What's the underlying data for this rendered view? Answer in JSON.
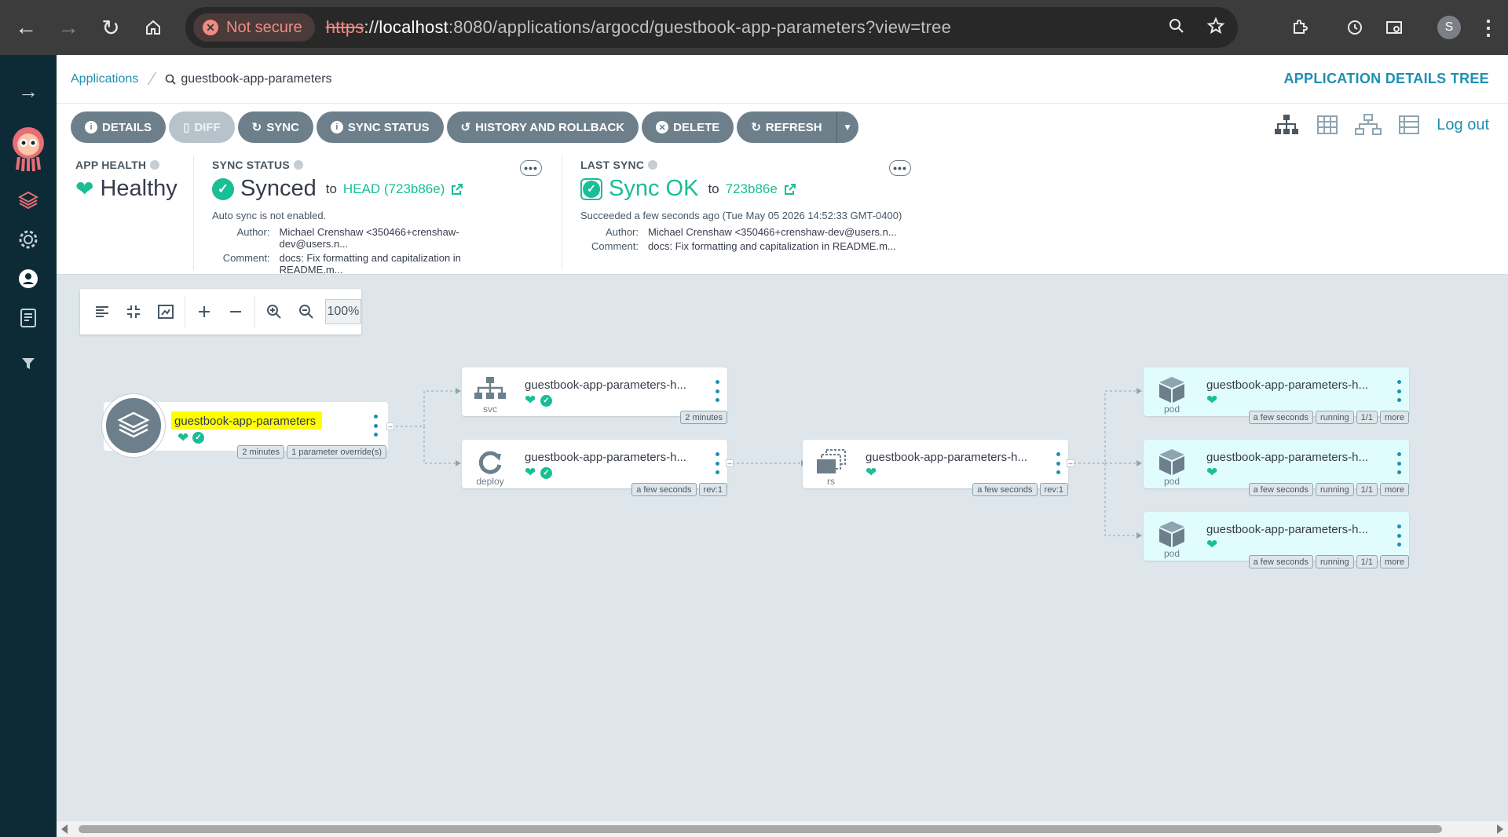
{
  "browser": {
    "security_label": "Not secure",
    "url_scheme": "https",
    "url_sep": "://",
    "url_host": "localhost",
    "url_path": ":8080/applications/argocd/guestbook-app-parameters?view=tree",
    "profile_initial": "S"
  },
  "breadcrumb": {
    "root": "Applications",
    "current": "guestbook-app-parameters"
  },
  "page_title": "APPLICATION DETAILS TREE",
  "toolbar": {
    "details": "DETAILS",
    "diff": "DIFF",
    "sync": "SYNC",
    "sync_status": "SYNC STATUS",
    "history": "HISTORY AND ROLLBACK",
    "delete": "DELETE",
    "refresh": "REFRESH",
    "logout": "Log out"
  },
  "app_health": {
    "title": "APP HEALTH",
    "value": "Healthy"
  },
  "sync_status": {
    "title": "SYNC STATUS",
    "value": "Synced",
    "to": "to",
    "revision": "HEAD (723b86e)",
    "auto_sync": "Auto sync is not enabled.",
    "author_label": "Author:",
    "author": "Michael Crenshaw <350466+crenshaw-dev@users.n...",
    "comment_label": "Comment:",
    "comment": "docs: Fix formatting and capitalization in README.m..."
  },
  "last_sync": {
    "title": "LAST SYNC",
    "value": "Sync OK",
    "to": "to",
    "revision": "723b86e",
    "succeeded": "Succeeded a few seconds ago (Tue May 05 2026 14:52:33 GMT-0400)",
    "author_label": "Author:",
    "author": "Michael Crenshaw <350466+crenshaw-dev@users.n...",
    "comment_label": "Comment:",
    "comment": "docs: Fix formatting and capitalization in README.m..."
  },
  "zoom": "100%",
  "colors": {
    "accent": "#1f8fb2",
    "healthy": "#18be94",
    "sidebar": "#0d2b36",
    "button": "#6d7f8b",
    "pod_bg": "#e1fcfd",
    "highlight": "#ffff00"
  },
  "tree": {
    "app": {
      "name": "guestbook-app-parameters",
      "tags": [
        "2 minutes",
        "1 parameter override(s)"
      ]
    },
    "svc": {
      "name": "guestbook-app-parameters-h...",
      "kind": "svc",
      "tags": [
        "2 minutes"
      ]
    },
    "deploy": {
      "name": "guestbook-app-parameters-h...",
      "kind": "deploy",
      "tags": [
        "a few seconds",
        "rev:1"
      ]
    },
    "rs": {
      "name": "guestbook-app-parameters-h...",
      "kind": "rs",
      "tags": [
        "a few seconds",
        "rev:1"
      ]
    },
    "pods": [
      {
        "name": "guestbook-app-parameters-h...",
        "kind": "pod",
        "tags": [
          "a few seconds",
          "running",
          "1/1",
          "more"
        ]
      },
      {
        "name": "guestbook-app-parameters-h...",
        "kind": "pod",
        "tags": [
          "a few seconds",
          "running",
          "1/1",
          "more"
        ]
      },
      {
        "name": "guestbook-app-parameters-h...",
        "kind": "pod",
        "tags": [
          "a few seconds",
          "running",
          "1/1",
          "more"
        ]
      }
    ]
  }
}
